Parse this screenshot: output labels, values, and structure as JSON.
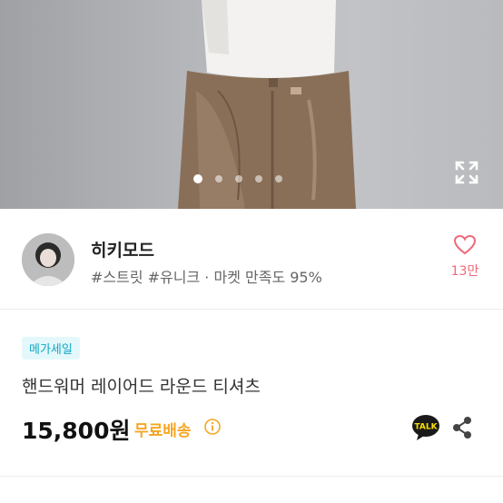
{
  "gallery": {
    "image_icon": "product-photo-jeans",
    "slide_count": 5,
    "active_slide": 1,
    "expand_icon": "expand-icon"
  },
  "seller": {
    "name": "히키모드",
    "tags": "#스트릿 #유니크 · 마켓 만족도 95%",
    "likes_count": "13만",
    "like_icon": "heart-icon"
  },
  "product": {
    "badge": "메가세일",
    "title": "핸드워머 레이어드 라운드 티셔츠",
    "price": "15,800원",
    "shipping": "무료배송",
    "talk_label": "TALK"
  },
  "colors": {
    "badge_text": "#13a6c3",
    "badge_bg": "#e4f8fb",
    "shipping": "#f5a623",
    "like": "#ef6a7a"
  }
}
